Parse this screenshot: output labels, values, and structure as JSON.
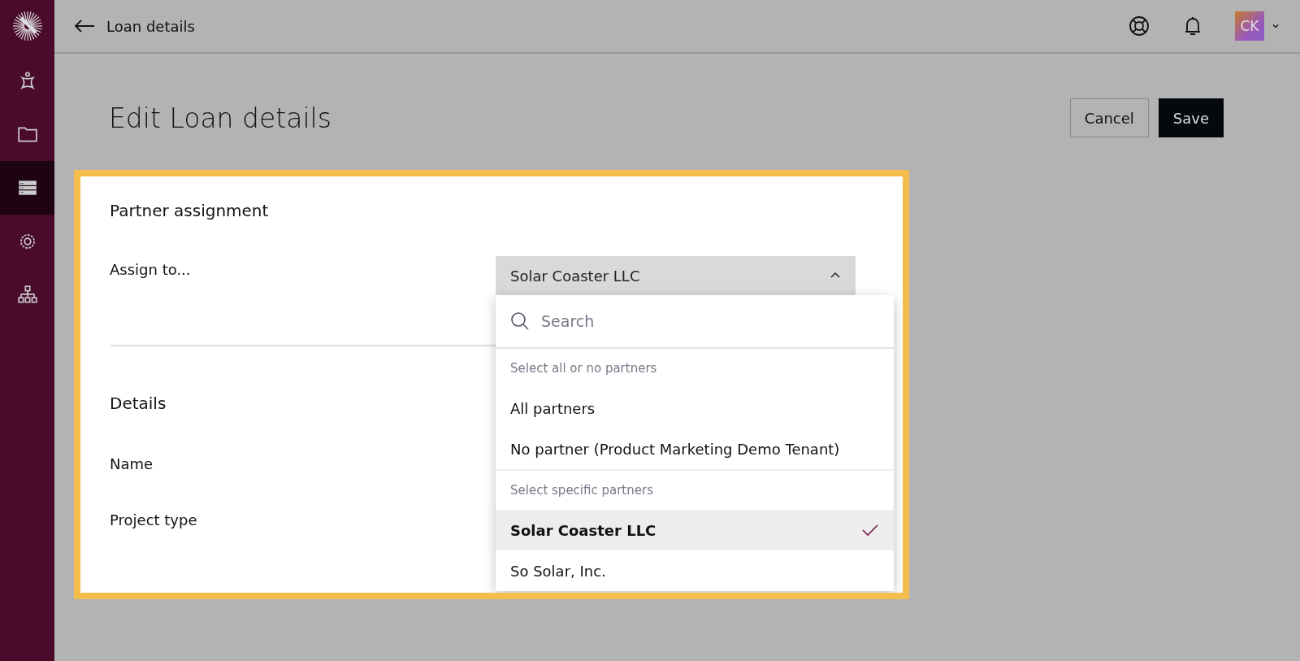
{
  "sidebar": {
    "items": [
      {
        "kind": "person",
        "selected": false
      },
      {
        "kind": "folder",
        "selected": false
      },
      {
        "kind": "list",
        "selected": true
      },
      {
        "kind": "gear",
        "selected": false
      },
      {
        "kind": "hierarchy",
        "selected": false
      }
    ]
  },
  "top_bar": {
    "back_label": "Loan details",
    "avatar_initials": "CK"
  },
  "page": {
    "title": "Edit Loan details",
    "buttons": [
      {
        "label": "Cancel",
        "kind": "secondary"
      },
      {
        "label": "Save",
        "kind": "primary"
      }
    ]
  },
  "card": {
    "section_title": "Partner assignment",
    "assign_label": "Assign to...",
    "dropdown": {
      "value": "Solar Coaster LLC",
      "expanded": true,
      "search_placeholder": "Search",
      "groups": [
        {
          "header": "Select all or no partners",
          "options": [
            {
              "label": "All partners",
              "selected": false
            },
            {
              "label": "No partner (Product Marketing Demo Tenant)",
              "selected": false
            }
          ]
        },
        {
          "header": "Select specific partners",
          "options": [
            {
              "label": "Solar Coaster LLC",
              "selected": true
            },
            {
              "label": "So Solar, Inc.",
              "selected": false
            }
          ]
        }
      ]
    },
    "details_title": "Details",
    "fields": [
      "Name",
      "Project type"
    ]
  }
}
